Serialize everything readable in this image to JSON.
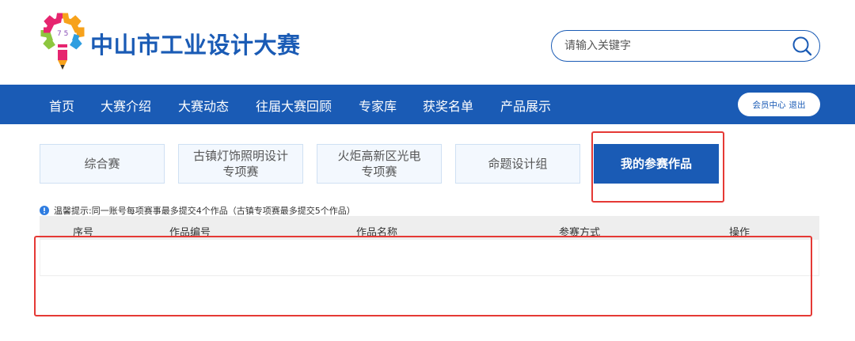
{
  "header": {
    "title": "中山市工业设计大赛",
    "logo_icon": "gear-pencil-logo",
    "search": {
      "placeholder": "请输入关键字",
      "value": "",
      "icon": "search-icon"
    }
  },
  "nav": {
    "items": [
      "首页",
      "大赛介绍",
      "大赛动态",
      "往届大赛回顾",
      "专家库",
      "获奖名单",
      "产品展示"
    ],
    "member_center": "会员中心",
    "logout": "退出"
  },
  "tabs": [
    {
      "line1": "综合赛",
      "line2": ""
    },
    {
      "line1": "古镇灯饰照明设计",
      "line2": "专项赛"
    },
    {
      "line1": "火炬高新区光电",
      "line2": "专项赛"
    },
    {
      "line1": "命题设计组",
      "line2": ""
    },
    {
      "line1": "我的参赛作品",
      "line2": "",
      "active": true
    }
  ],
  "tip": {
    "icon": "info-icon",
    "text": "温馨提示:同一账号每项赛事最多提交4个作品（古镇专项赛最多提交5个作品）"
  },
  "table": {
    "columns": [
      "序号",
      "作品编号",
      "作品名称",
      "参赛方式",
      "操作"
    ],
    "rows": []
  },
  "colors": {
    "brand_blue": "#1a5bb5",
    "highlight_red": "#e53935",
    "tab_bg": "#f3f8fe"
  }
}
